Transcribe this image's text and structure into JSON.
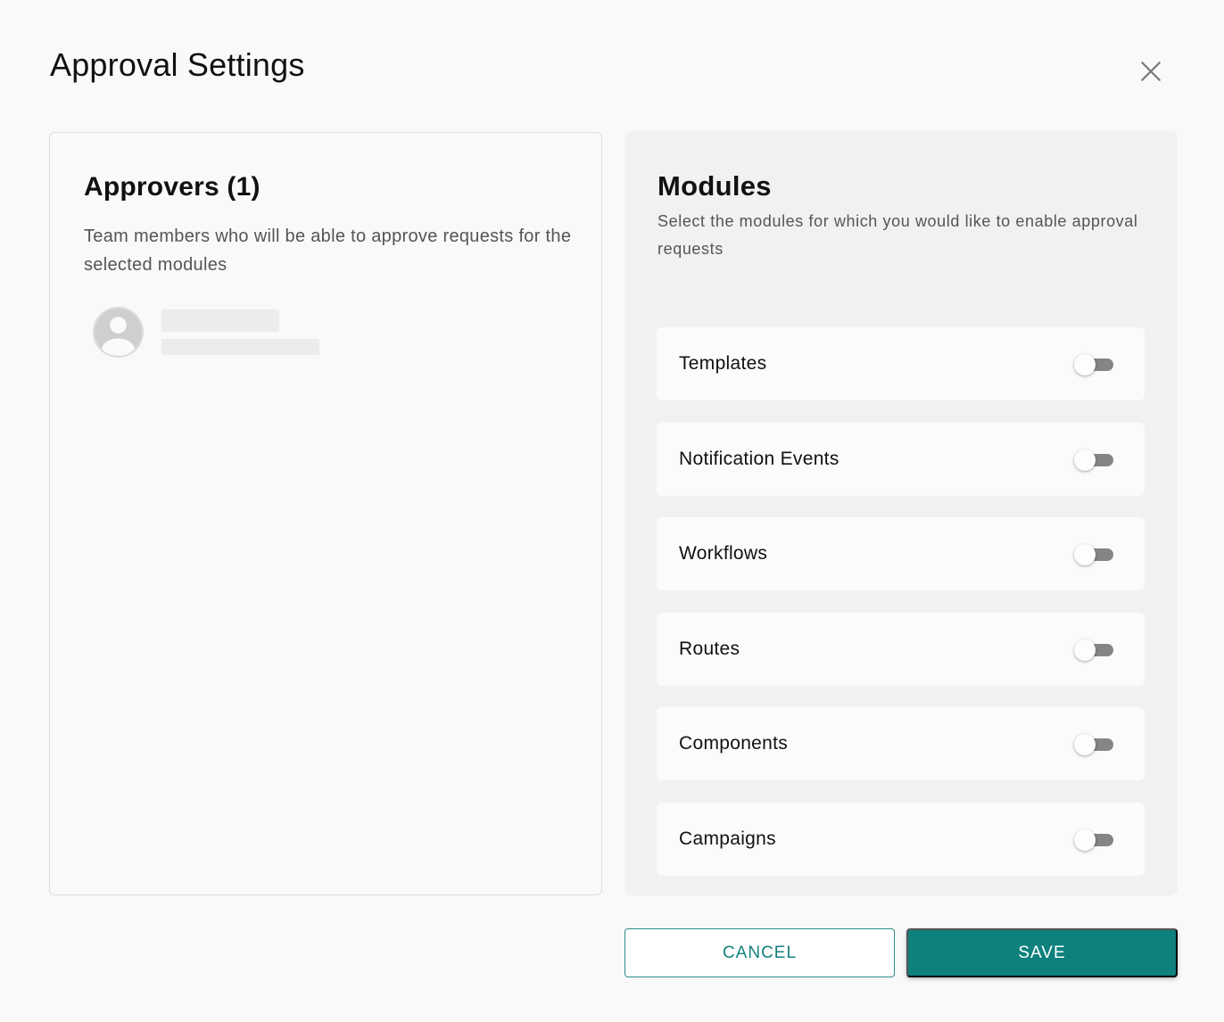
{
  "dialog": {
    "title": "Approval Settings",
    "close_icon": "close-icon"
  },
  "approvers": {
    "title": "Approvers (1)",
    "description": "Team members who will be able to approve requests for the selected modules",
    "avatar_icon": "user-avatar-icon"
  },
  "modules": {
    "title": "Modules",
    "description": "Select the modules for which you would like to enable approval requests",
    "items": [
      {
        "label": "Templates",
        "enabled": false
      },
      {
        "label": "Notification Events",
        "enabled": false
      },
      {
        "label": "Workflows",
        "enabled": false
      },
      {
        "label": "Routes",
        "enabled": false
      },
      {
        "label": "Components",
        "enabled": false
      },
      {
        "label": "Campaigns",
        "enabled": false
      }
    ]
  },
  "actions": {
    "cancel_label": "CANCEL",
    "save_label": "SAVE"
  },
  "colors": {
    "accent": "#0e817c",
    "toggle_off": "#858585"
  }
}
